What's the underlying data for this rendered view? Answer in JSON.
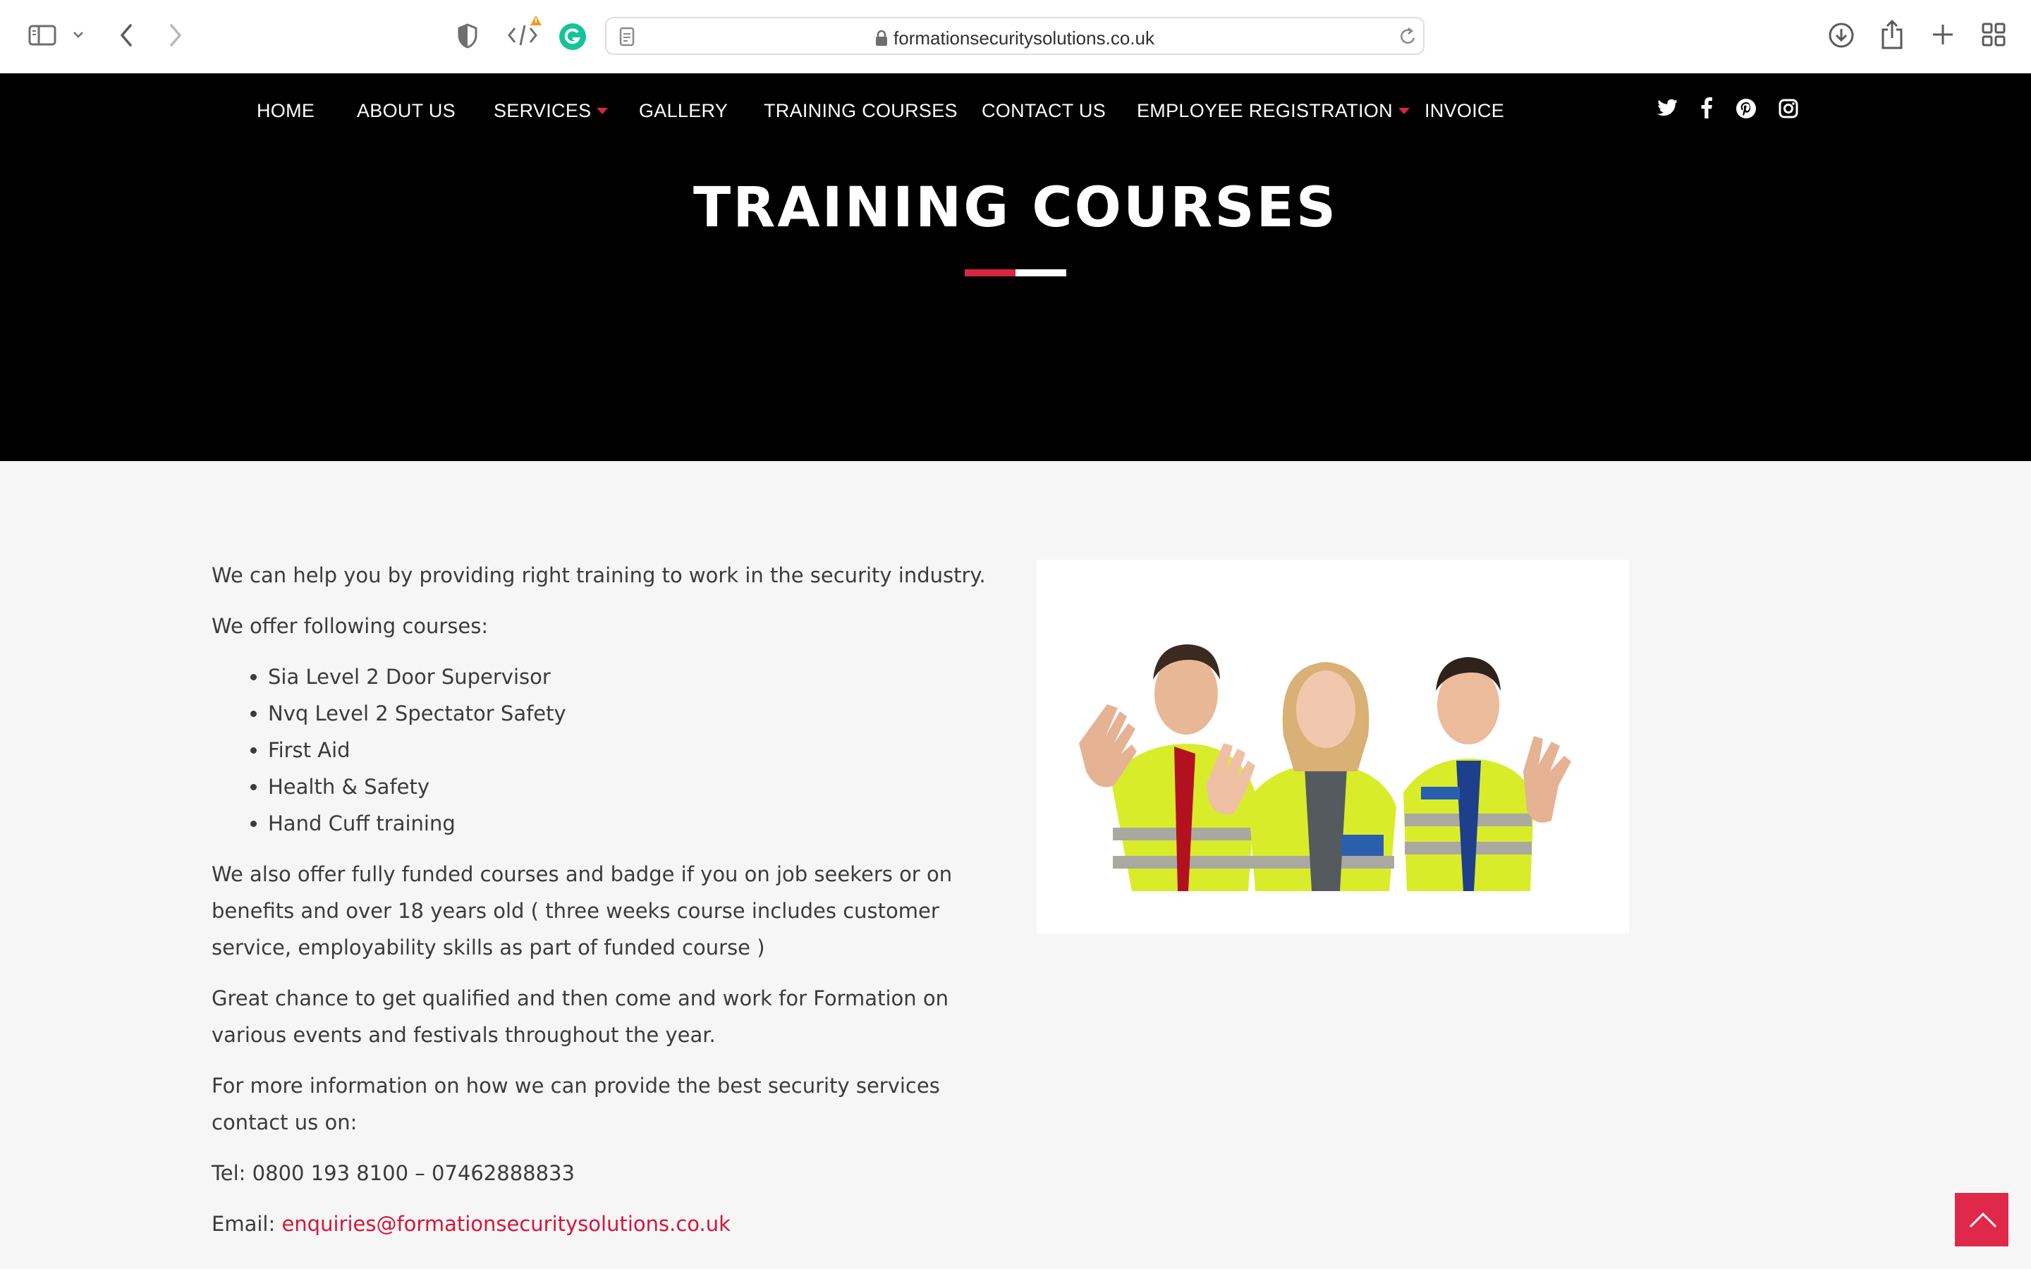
{
  "browser": {
    "url": "formationsecuritysolutions.co.uk",
    "icons": [
      "sidebar-icon",
      "chevron-down-icon",
      "back-icon",
      "forward-icon",
      "shield-icon",
      "code-icon",
      "grammarly-icon",
      "page-icon",
      "lock-icon",
      "reload-icon",
      "download-icon",
      "share-icon",
      "new-tab-icon",
      "tab-overview-icon"
    ]
  },
  "nav": {
    "items": [
      {
        "label": "HOME"
      },
      {
        "label": "ABOUT US"
      },
      {
        "label": "SERVICES",
        "has_dropdown": true
      },
      {
        "label": "GALLERY"
      },
      {
        "label": "TRAINING COURSES"
      },
      {
        "label": "CONTACT US"
      },
      {
        "label": "EMPLOYEE REGISTRATION",
        "has_dropdown": true
      },
      {
        "label": "INVOICE"
      }
    ],
    "social_icons": [
      "twitter-icon",
      "facebook-icon",
      "pinterest-icon",
      "instagram-icon"
    ]
  },
  "hero": {
    "title": "TRAINING COURSES"
  },
  "content": {
    "intro": "We can help you by providing right training to work in the security industry.",
    "offer_heading": "We offer following courses:",
    "courses": [
      "Sia Level 2 Door Supervisor",
      "Nvq Level 2 Spectator Safety",
      "First Aid",
      "Health & Safety",
      "Hand Cuff training"
    ],
    "funded": "We also offer fully funded courses and badge if you on job seekers or on benefits and over 18 years old ( three weeks course includes customer service, employability skills as part of funded course )",
    "chance": "Great chance to get qualified and then come and work for Formation on various events and festivals throughout the year.",
    "more_info": "For more information on how we can provide the best security services contact us on:",
    "tel": "Tel: 0800 193 8100 – 07462888833",
    "email_label": "Email: ",
    "email": "enquiries@formationsecuritysolutions.co.uk"
  },
  "colors": {
    "accent": "#d7263d",
    "hero_bg": "#000000",
    "page_bg": "#f6f6f6",
    "vest": "#d9ec2a"
  }
}
